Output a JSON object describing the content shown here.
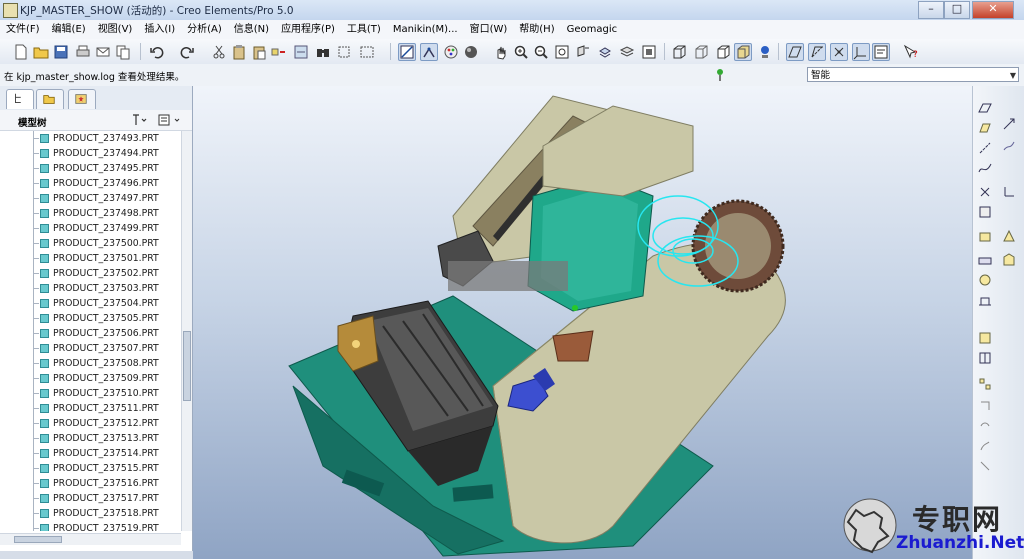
{
  "window": {
    "title": "KJP_MASTER_SHOW (活动的) - Creo Elements/Pro 5.0",
    "minimize": "–",
    "maximize": "□",
    "close": "✕"
  },
  "menu": [
    "文件(F)",
    "编辑(E)",
    "视图(V)",
    "插入(I)",
    "分析(A)",
    "信息(N)",
    "应用程序(P)",
    "工具(T)",
    "Manikin(M)...",
    "窗口(W)",
    "帮助(H)",
    "Geomagic"
  ],
  "status": {
    "message": "在 kjp_master_show.log 查看处理结果。",
    "filter_value": "智能"
  },
  "tree": {
    "title": "模型树",
    "items": [
      "PRODUCT_237493.PRT",
      "PRODUCT_237494.PRT",
      "PRODUCT_237495.PRT",
      "PRODUCT_237496.PRT",
      "PRODUCT_237497.PRT",
      "PRODUCT_237498.PRT",
      "PRODUCT_237499.PRT",
      "PRODUCT_237500.PRT",
      "PRODUCT_237501.PRT",
      "PRODUCT_237502.PRT",
      "PRODUCT_237503.PRT",
      "PRODUCT_237504.PRT",
      "PRODUCT_237505.PRT",
      "PRODUCT_237506.PRT",
      "PRODUCT_237507.PRT",
      "PRODUCT_237508.PRT",
      "PRODUCT_237509.PRT",
      "PRODUCT_237510.PRT",
      "PRODUCT_237511.PRT",
      "PRODUCT_237512.PRT",
      "PRODUCT_237513.PRT",
      "PRODUCT_237514.PRT",
      "PRODUCT_237515.PRT",
      "PRODUCT_237516.PRT",
      "PRODUCT_237517.PRT",
      "PRODUCT_237518.PRT",
      "PRODUCT_237519.PRT"
    ]
  },
  "watermark": {
    "cn": "专职网",
    "en": "Zhuanzhi.Net"
  },
  "colors": {
    "part_cyan": "#68c9ce",
    "model_khaki": "#c9c7a6",
    "model_teal": "#1f8f7c",
    "model_dark": "#3d3d3d"
  },
  "icons": {
    "toolbar": [
      "new-icon",
      "open-icon",
      "save-icon",
      "print-icon",
      "email-icon",
      "copy-icon",
      "undo-icon",
      "redo-icon",
      "cut-icon",
      "paste-icon",
      "regenerate-icon",
      "find-icon",
      "select-icon",
      "sketch-icon",
      "datum-icon",
      "appearance-icon",
      "sphere-icon",
      "pan-icon",
      "zoom-in-icon",
      "zoom-out-icon",
      "refit-icon",
      "orient-icon",
      "layers-icon",
      "saved-views-icon",
      "wireframe-icon",
      "hidden-line-icon",
      "no-hidden-icon",
      "shading-icon",
      "enhanced-realism-icon",
      "datum-plane-icon",
      "datum-axis-icon",
      "datum-point-icon",
      "coordinate-system-icon",
      "whats-this-icon"
    ],
    "right": [
      "plane-icon",
      "datum-plane-tool-icon",
      "axis-icon",
      "dim-icon",
      "curve-icon",
      "sketch-curve-icon",
      "point-icon",
      "coord-icon",
      "analysis-icon",
      "extrude-icon",
      "revolve-icon",
      "rib-icon",
      "hole-icon",
      "round-icon",
      "chamfer-icon",
      "draft-icon",
      "shell-icon",
      "mirror-icon",
      "pattern-icon",
      "merge-icon",
      "trim-icon",
      "offset-icon"
    ]
  }
}
